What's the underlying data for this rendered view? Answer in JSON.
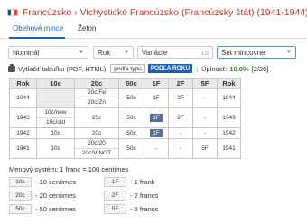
{
  "header": {
    "flag_colors": [
      "#0055a4",
      "#ffffff",
      "#ef4135"
    ],
    "title": "Francúzsko › Vichystické Francúzsko (Francúzsky štát) (1941-1944)"
  },
  "tabs": [
    {
      "label": "Obehové mince",
      "active": true
    },
    {
      "label": "Žeton",
      "active": false
    }
  ],
  "filters": {
    "nominal": "Nominál",
    "year": "Rok",
    "variations": "Variácie",
    "variations_count": "15",
    "coin_set": "Set mincovne"
  },
  "toolbar": {
    "print_label": "Vytlačiť tabuľku (PDF, HTML)",
    "by_type_label": "podľa typu",
    "by_year_label": "PODĽA ROKU",
    "completeness_label": "Úplnosť:",
    "completeness_pct": "10.0%",
    "completeness_count": "[2/20]"
  },
  "table": {
    "headers": [
      "Rok",
      "10c",
      "20c",
      "50c",
      "1F",
      "2F",
      "5F",
      "Rok"
    ],
    "rows": [
      {
        "year": "1944",
        "c10": "",
        "c20": [
          "20c/Fe",
          "20c/Zn"
        ],
        "c50": "50c",
        "f1": "1F",
        "f2": "2F",
        "f5": "-",
        "year2": "1944"
      },
      {
        "year": "1943",
        "c10": [
          "10c/new",
          "10c/old"
        ],
        "c20": "20c",
        "c50": "50c",
        "f1": "1F",
        "f2": "2F",
        "f5": "-",
        "year2": "1943"
      },
      {
        "year": "1942",
        "c10": "10c",
        "c20": "20c",
        "c50": "50c",
        "f1": "1F",
        "f2": "-",
        "f5": "-",
        "year2": "1942"
      },
      {
        "year": "1941",
        "c10": "10c",
        "c20": [
          "20c/20",
          "20c/VINGT"
        ],
        "c50": "50c",
        "f1": "-",
        "f2": "-",
        "f5": "5F",
        "year2": "1941"
      }
    ]
  },
  "currency": "Menový systém: 1 franc = 100 centimes",
  "legend": [
    {
      "badge": "10c",
      "text": "- 10 centimes"
    },
    {
      "badge": "1F",
      "text": "- 1 frank"
    },
    {
      "badge": "20c",
      "text": "- 20 centimes"
    },
    {
      "badge": "2F",
      "text": "- 2 francs"
    },
    {
      "badge": "50c",
      "text": "- 50 centimes"
    },
    {
      "badge": "5F",
      "text": "- 5 francs"
    }
  ]
}
